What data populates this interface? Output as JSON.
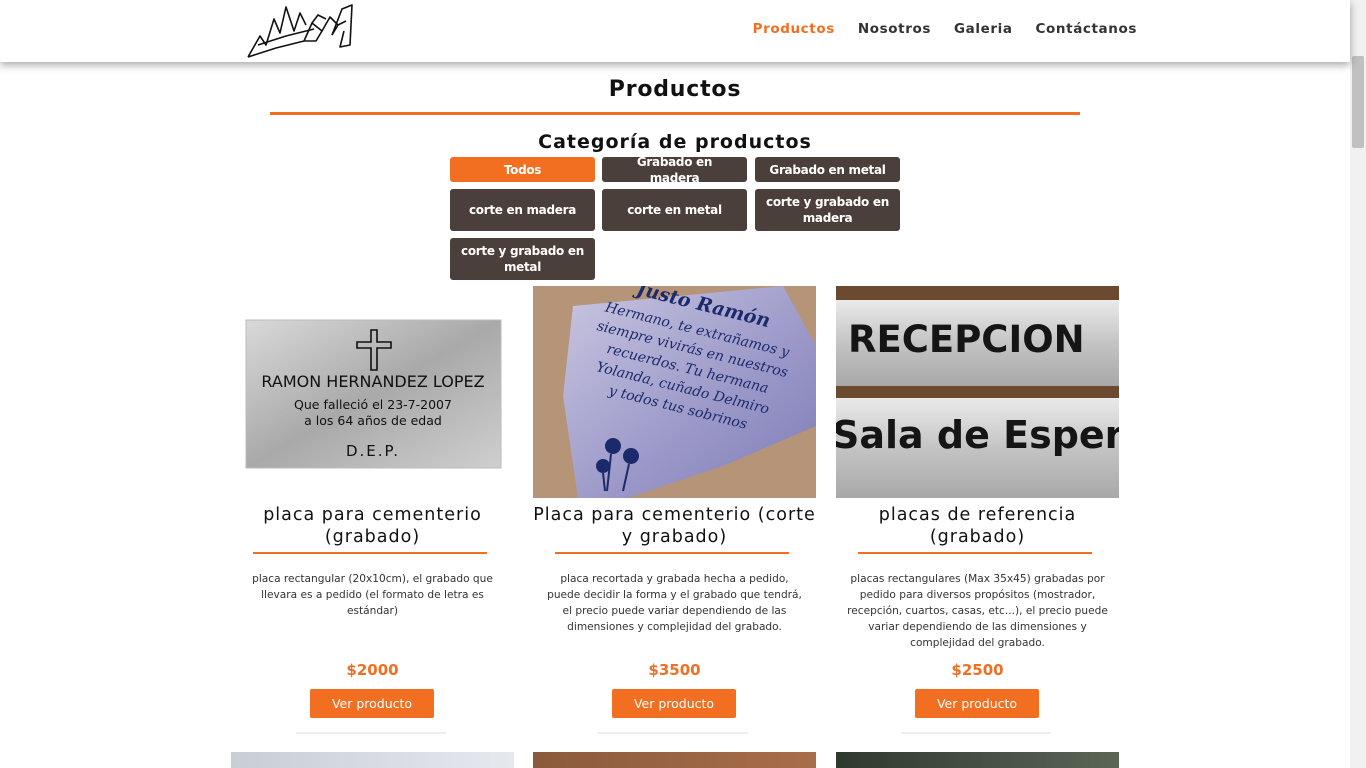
{
  "header": {
    "nav": [
      {
        "label": "Productos",
        "active": true
      },
      {
        "label": "Nosotros",
        "active": false
      },
      {
        "label": "Galeria",
        "active": false
      },
      {
        "label": "Contáctanos",
        "active": false
      }
    ]
  },
  "main": {
    "title": "Productos",
    "category_title": "Categoría de productos",
    "categories": [
      {
        "label": "Todos",
        "active": true
      },
      {
        "label": "Grabado en madera",
        "active": false
      },
      {
        "label": "Grabado en metal",
        "active": false
      },
      {
        "label": "corte en madera",
        "active": false
      },
      {
        "label": "corte en metal",
        "active": false
      },
      {
        "label": "corte y grabado en madera",
        "active": false
      },
      {
        "label": "corte y grabado en metal",
        "active": false
      }
    ],
    "products": [
      {
        "title": "placa para cementerio (grabado)",
        "description": "placa rectangular (20x10cm), el grabado que llevara es a pedido (el formato de letra es estándar)",
        "price": "$2000",
        "button": "Ver producto",
        "image_text": {
          "name": "RAMON HERNANDEZ LOPEZ",
          "line1": "Que falleció el 23-7-2007",
          "line2": "a los 64 años de edad",
          "line3": "D.E.P."
        }
      },
      {
        "title": "Placa para cementerio (corte y grabado)",
        "description": "placa recortada y grabada hecha a pedido, puede decidir la forma y el grabado que tendrá, el precio puede variar dependiendo de las dimensiones y complejidad del grabado.",
        "price": "$3500",
        "button": "Ver producto",
        "image_text": {
          "line1": "Justo Ramón",
          "line2": "Hermano, te extrañamos y",
          "line3": "siempre vivirás en nuestros",
          "line4": "recuerdos. Tu hermana",
          "line5": "Yolanda, cuñado Delmiro",
          "line6": "y todos tus sobrinos"
        }
      },
      {
        "title": "placas de referencia (grabado)",
        "description": "placas rectangulares (Max 35x45) grabadas por pedido para diversos propósitos (mostrador, recepción, cuartos, casas, etc...), el precio puede variar dependiendo de las dimensiones y complejidad del grabado.",
        "price": "$2500",
        "button": "Ver producto",
        "image_text": {
          "line1": "RECEPCION",
          "line2": "Sala de Espera"
        }
      }
    ]
  },
  "colors": {
    "accent": "#f26f21",
    "category_button": "#4a3f3b"
  },
  "icons": [
    "logo"
  ]
}
